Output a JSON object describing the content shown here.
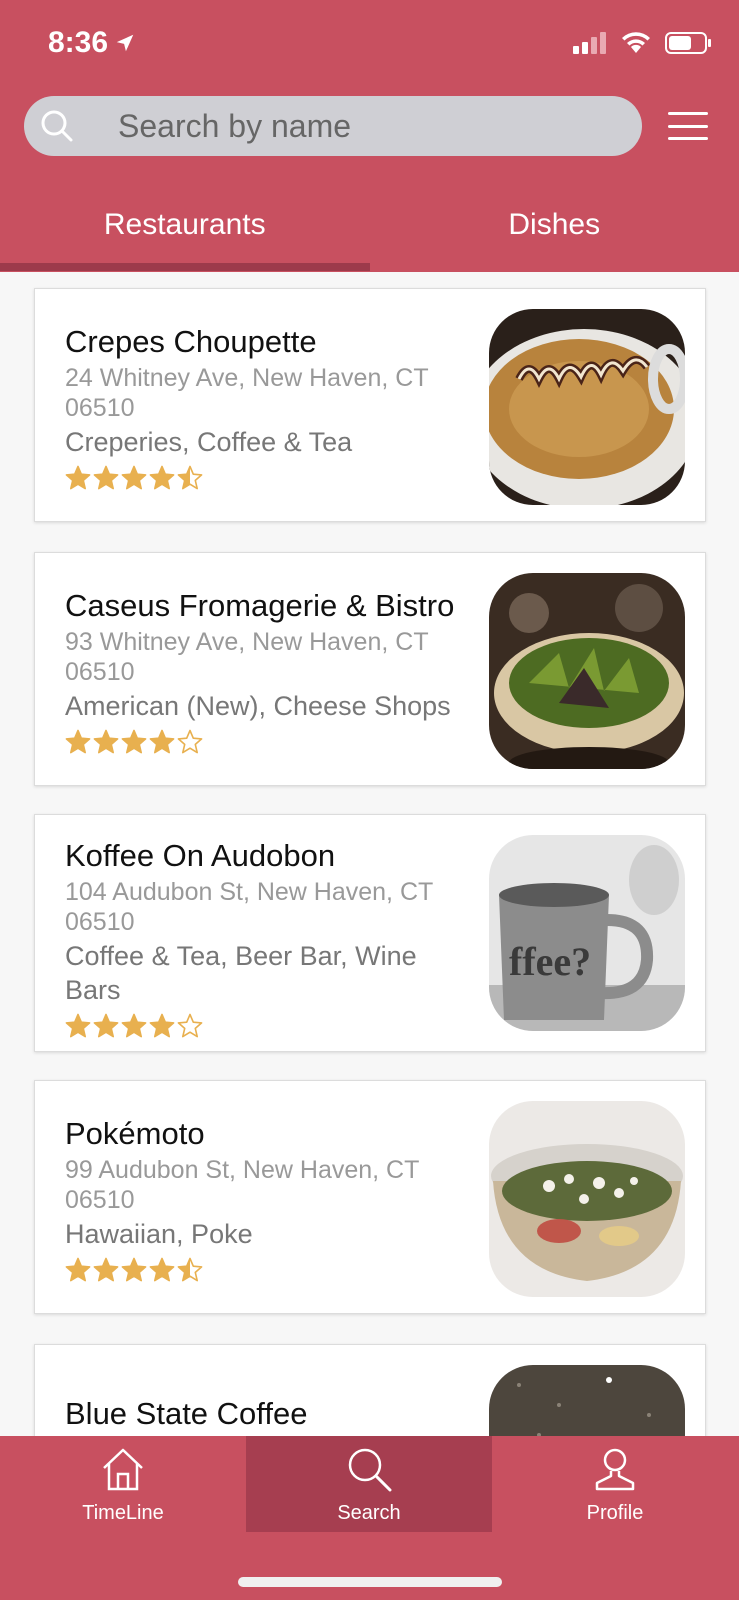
{
  "status": {
    "time": "8:36"
  },
  "search": {
    "placeholder": "Search by name"
  },
  "tabs": [
    {
      "label": "Restaurants",
      "active": true
    },
    {
      "label": "Dishes",
      "active": false
    }
  ],
  "restaurants": [
    {
      "name": "Crepes Choupette",
      "address": "24 Whitney Ave, New Haven, CT 06510",
      "categories": "Creperies, Coffee & Tea",
      "rating": 4.5,
      "photo": "latte-art"
    },
    {
      "name": "Caseus Fromagerie & Bistro",
      "address": "93 Whitney Ave, New Haven, CT 06510",
      "categories": "American (New), Cheese Shops",
      "rating": 4,
      "photo": "salad-bowl"
    },
    {
      "name": "Koffee On Audobon",
      "address": "104 Audubon St, New Haven, CT 06510",
      "categories": "Coffee & Tea, Beer Bar, Wine Bars",
      "rating": 4,
      "photo": "coffee-mug-bw"
    },
    {
      "name": "Pokémoto",
      "address": "99 Audubon St, New Haven, CT 06510",
      "categories": "Hawaiian, Poke",
      "rating": 4.5,
      "photo": "poke-bowl"
    },
    {
      "name": "Blue State Coffee",
      "address": "",
      "categories": "",
      "rating": null,
      "photo": "countertop"
    }
  ],
  "tabbar": [
    {
      "label": "TimeLine",
      "icon": "home-icon",
      "active": false
    },
    {
      "label": "Search",
      "icon": "search-icon",
      "active": true
    },
    {
      "label": "Profile",
      "icon": "person-icon",
      "active": false
    }
  ],
  "colors": {
    "brand": "#c85060",
    "brand_dark": "#a63e50",
    "star": "#e8b04f"
  }
}
